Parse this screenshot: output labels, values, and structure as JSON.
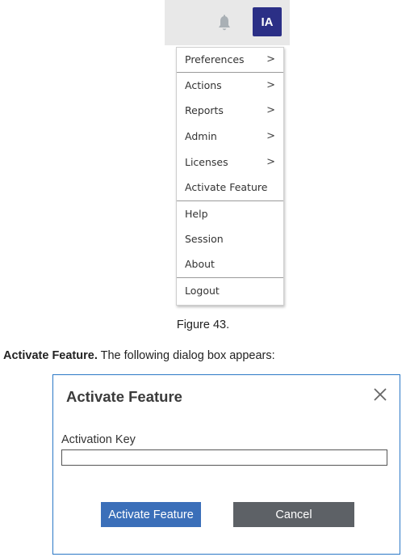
{
  "header": {
    "avatar_initials": "IA",
    "bell_icon": "bell-icon",
    "bar_color": "#e8e8e8",
    "avatar_color": "#2b2f86"
  },
  "menu": {
    "items": [
      {
        "label": "Preferences",
        "has_submenu": true
      },
      {
        "label": "Actions",
        "has_submenu": true
      },
      {
        "label": "Reports",
        "has_submenu": true
      },
      {
        "label": "Admin",
        "has_submenu": true
      },
      {
        "label": "Licenses",
        "has_submenu": true
      },
      {
        "label": "Activate Feature",
        "has_submenu": false
      },
      {
        "label": "Help",
        "has_submenu": false
      },
      {
        "label": "Session",
        "has_submenu": false
      },
      {
        "label": "About",
        "has_submenu": false
      },
      {
        "label": "Logout",
        "has_submenu": false
      }
    ],
    "chevron": ">"
  },
  "caption": "Figure 43.",
  "instruction": {
    "bold": "Activate Feature.",
    "rest": " The following dialog box appears:"
  },
  "dialog": {
    "title": "Activate Feature",
    "close_icon": "close-icon",
    "key_label": "Activation Key",
    "key_value": "",
    "primary_button": "Activate Feature",
    "cancel_button": "Cancel",
    "border_color": "#2b78c6",
    "primary_color": "#3b6fb9",
    "cancel_color": "#5d6166"
  }
}
